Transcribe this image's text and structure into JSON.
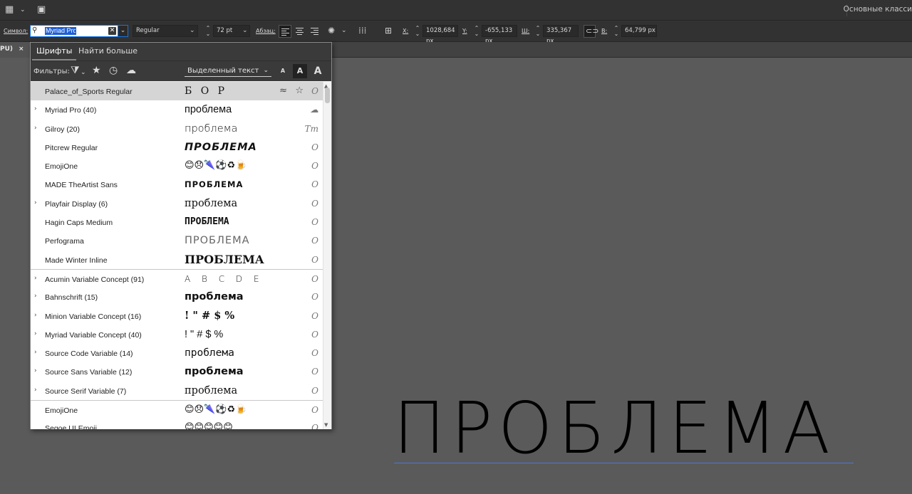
{
  "workspace": {
    "name": "Основные класси"
  },
  "control": {
    "symbol_label": "Символ:",
    "font_value": "Myriad Pro",
    "clear_glyph": "✕",
    "style": "Regular",
    "size": "72 pt",
    "paragraph_label": "Абзац:",
    "x_label": "X:",
    "x_value": "1028,684 px",
    "y_label": "Y:",
    "y_value": "-655,133 px",
    "w_label": "Ш:",
    "w_value": "335,367 px",
    "h_label": "В:",
    "h_value": "64,799 px"
  },
  "doc_tab": {
    "label": "PU)",
    "close": "×"
  },
  "panel": {
    "tabs": [
      {
        "label": "Шрифты",
        "active": true
      },
      {
        "label": "Найти больше",
        "active": false
      }
    ],
    "filters_label": "Фильтры:",
    "sample_select": "Выделенный текст",
    "size_buttons": [
      "A",
      "A",
      "A"
    ],
    "fonts": [
      {
        "name": "Palace_of_Sports Regular",
        "sample": "Б О Р",
        "expandable": false,
        "type": "O",
        "selected": true,
        "sep": false
      },
      {
        "name": "Myriad Pro (40)",
        "sample": "проблема",
        "expandable": true,
        "type": "☁",
        "selected": false,
        "sep": false
      },
      {
        "name": "Gilroy (20)",
        "sample": "проблема",
        "expandable": true,
        "type": "Tт",
        "selected": false,
        "sep": false
      },
      {
        "name": "Pitcrew Regular",
        "sample": "ПРОБЛЕМА",
        "expandable": false,
        "type": "O",
        "selected": false,
        "sep": false
      },
      {
        "name": "EmojiOne",
        "sample": "😊😞🌂⚽♻🍺",
        "expandable": false,
        "type": "O",
        "selected": false,
        "sep": false
      },
      {
        "name": "MADE TheArtist Sans",
        "sample": "ПРОБЛЕМА",
        "expandable": false,
        "type": "O",
        "selected": false,
        "sep": false
      },
      {
        "name": "Playfair Display (6)",
        "sample": "проблема",
        "expandable": true,
        "type": "O",
        "selected": false,
        "sep": false
      },
      {
        "name": "Hagin Caps Medium",
        "sample": "ПРОБЛЕМА",
        "expandable": false,
        "type": "O",
        "selected": false,
        "sep": false
      },
      {
        "name": "Perfograma",
        "sample": "ПРОБЛЕМА",
        "expandable": false,
        "type": "O",
        "selected": false,
        "sep": false
      },
      {
        "name": "Made Winter Inline",
        "sample": "ПРОБЛЕМА",
        "expandable": false,
        "type": "O",
        "selected": false,
        "sep": false
      },
      {
        "name": "Acumin Variable Concept (91)",
        "sample": "A B C D E",
        "expandable": true,
        "type": "O",
        "selected": false,
        "sep": true
      },
      {
        "name": "Bahnschrift (15)",
        "sample": "проблема",
        "expandable": true,
        "type": "O",
        "selected": false,
        "sep": false
      },
      {
        "name": "Minion Variable Concept (16)",
        "sample": "! \" # $ %",
        "expandable": true,
        "type": "O",
        "selected": false,
        "sep": false
      },
      {
        "name": "Myriad Variable Concept (40)",
        "sample": "! \" # $ %",
        "expandable": true,
        "type": "O",
        "selected": false,
        "sep": false
      },
      {
        "name": "Source Code Variable (14)",
        "sample": "проблема",
        "expandable": true,
        "type": "O",
        "selected": false,
        "sep": false
      },
      {
        "name": "Source Sans Variable (12)",
        "sample": "проблема",
        "expandable": true,
        "type": "O",
        "selected": false,
        "sep": false
      },
      {
        "name": "Source Serif Variable (7)",
        "sample": "проблема",
        "expandable": true,
        "type": "O",
        "selected": false,
        "sep": false
      },
      {
        "name": "EmojiOne",
        "sample": "😊😞🌂⚽♻🍺",
        "expandable": false,
        "type": "O",
        "selected": false,
        "sep": true
      },
      {
        "name": "Segoe UI Emoji",
        "sample": "😊😊😊😊😊",
        "expandable": false,
        "type": "O",
        "selected": false,
        "sep": false
      }
    ]
  },
  "canvas": {
    "art_text": "ПРОБЛЕМА"
  }
}
